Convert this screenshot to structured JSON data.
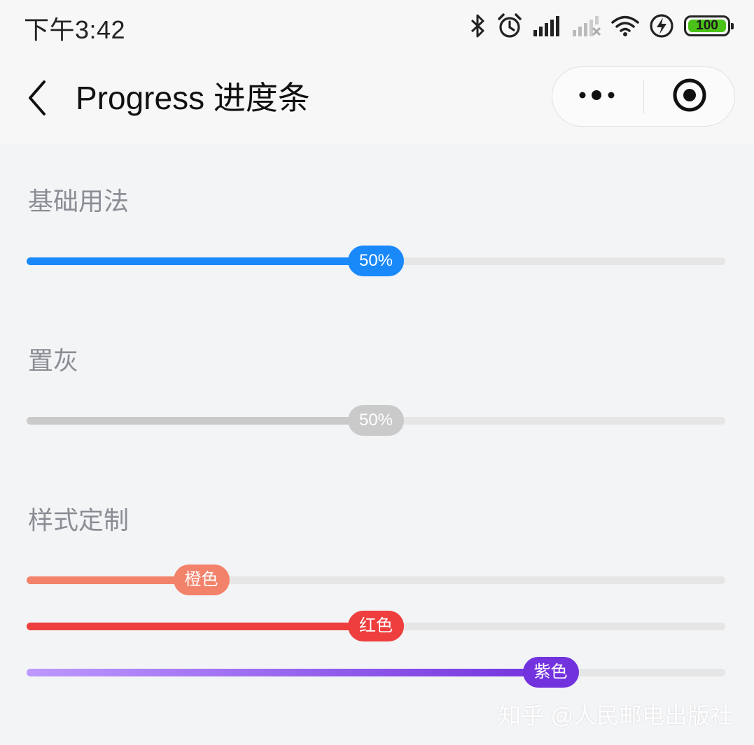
{
  "status_bar": {
    "time": "下午3:42",
    "battery": "100",
    "icons": [
      "bluetooth-icon",
      "alarm-icon",
      "signal-icon",
      "signal-weak-icon",
      "wifi-icon",
      "charging-icon",
      "battery-icon"
    ]
  },
  "nav": {
    "title": "Progress 进度条",
    "back_icon": "chevron-left-icon",
    "more_icon": "more-dots-icon",
    "close_icon": "target-icon"
  },
  "sections": [
    {
      "title": "基础用法",
      "bars": [
        {
          "label": "50%",
          "percent": 50,
          "color": "#1989fa"
        }
      ]
    },
    {
      "title": "置灰",
      "bars": [
        {
          "label": "50%",
          "percent": 50,
          "color": "#cacaca"
        }
      ]
    },
    {
      "title": "样式定制",
      "bars": [
        {
          "label": "橙色",
          "percent": 25,
          "color": "#f2826a"
        },
        {
          "label": "红色",
          "percent": 50,
          "color": "#ee3e3e"
        },
        {
          "label": "紫色",
          "percent": 75,
          "color_start": "#be99ff",
          "color_end": "#7232dd"
        }
      ]
    }
  ],
  "watermark": "知乎 @人民邮电出版社"
}
